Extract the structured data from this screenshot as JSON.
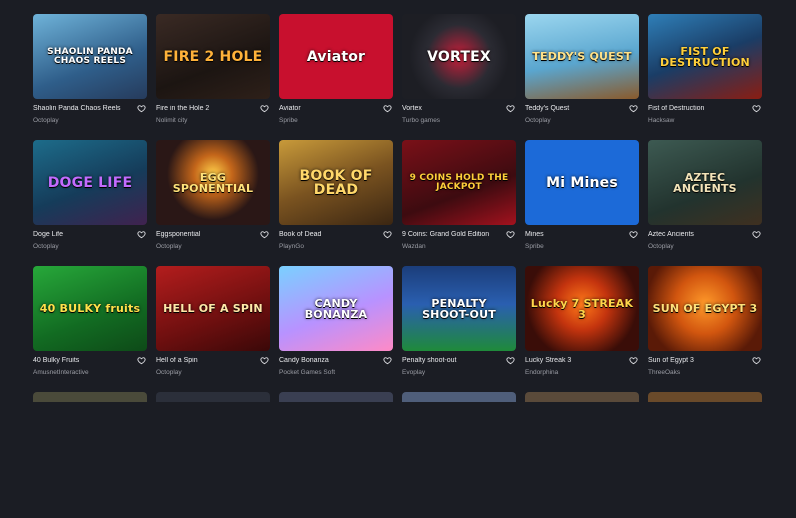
{
  "games": [
    {
      "title": "Shaolin Panda Chaos Reels",
      "provider": "Octoplay",
      "art": "SHAOLIN PANDA CHAOS REELS",
      "bg": "linear-gradient(160deg,#6fb3d9,#2f5e8a 60%,#263b5c)",
      "fg": "#ffffff"
    },
    {
      "title": "Fire in the Hole 2",
      "provider": "Nolimit city",
      "art": "FIRE 2 HOLE",
      "bg": "linear-gradient(160deg,#3a2a24,#1c1512 60%,#2e2019)",
      "fg": "#ffb23a"
    },
    {
      "title": "Aviator",
      "provider": "Spribe",
      "art": "Aviator",
      "bg": "#c8102e",
      "fg": "#ffffff"
    },
    {
      "title": "Vortex",
      "provider": "Turbo games",
      "art": "VORTEX",
      "bg": "radial-gradient(circle,#c81e3a 0,#2b2b33 45%,#1d1e24 70%)",
      "fg": "#ffffff"
    },
    {
      "title": "Teddy's Quest",
      "provider": "Octoplay",
      "art": "TEDDY'S QUEST",
      "bg": "linear-gradient(170deg,#9bd6ef,#5aa6cf 55%,#8a5a2b)",
      "fg": "#ffe28a"
    },
    {
      "title": "Fist of Destruction",
      "provider": "Hacksaw",
      "art": "FIST OF DESTRUCTION",
      "bg": "linear-gradient(160deg,#2f7fb8,#1a3d66 50%,#8a1d12)",
      "fg": "#ffcf3a"
    },
    {
      "title": "Doge Life",
      "provider": "Octoplay",
      "art": "DOGE LIFE",
      "bg": "linear-gradient(160deg,#1d6c8a,#153c5a 55%,#40224f)",
      "fg": "#c36bff"
    },
    {
      "title": "Eggsponential",
      "provider": "Octoplay",
      "art": "EGG SPONENTIAL",
      "bg": "radial-gradient(circle at 50% 40%,#ffcf4a 0,#c4661a 25%,#2a1716 60%)",
      "fg": "#ffe27a"
    },
    {
      "title": "Book of Dead",
      "provider": "PlaynGo",
      "art": "BOOK OF DEAD",
      "bg": "linear-gradient(160deg,#c89a3a,#7a5320 50%,#3b2612)",
      "fg": "#ffd86a"
    },
    {
      "title": "9 Coins: Grand Gold Edition",
      "provider": "Wazdan",
      "art": "9 COINS HOLD THE JACKPOT",
      "bg": "linear-gradient(160deg,#7a1018,#3d0b10 60%,#a3121e)",
      "fg": "#ffcf3a"
    },
    {
      "title": "Mines",
      "provider": "Spribe",
      "art": "Mi Mines",
      "bg": "#1c6ad8",
      "fg": "#ffffff"
    },
    {
      "title": "Aztec Ancients",
      "provider": "Octoplay",
      "art": "AZTEC ANCIENTS",
      "bg": "linear-gradient(160deg,#3d5a52,#22332e 60%,#3f3020)",
      "fg": "#f2e3b8"
    },
    {
      "title": "40 Bulky Fruits",
      "provider": "AmusnetInteractive",
      "art": "40 BULKY fruits",
      "bg": "linear-gradient(160deg,#27a83a,#126b22 60%,#0e4a18)",
      "fg": "#ffe14a"
    },
    {
      "title": "Hell of a Spin",
      "provider": "Octoplay",
      "art": "HELL OF A SPIN",
      "bg": "linear-gradient(160deg,#b31d1d,#6e0f0f 60%,#3a0808)",
      "fg": "#ffe8a8"
    },
    {
      "title": "Candy Bonanza",
      "provider": "Pocket Games Soft",
      "art": "CANDY BONANZA",
      "bg": "linear-gradient(160deg,#7ad0ff,#b892ff 55%,#ff8ac6)",
      "fg": "#ffffff"
    },
    {
      "title": "Penalty shoot-out",
      "provider": "Evoplay",
      "art": "PENALTY SHOOT-OUT",
      "bg": "linear-gradient(180deg,#1b3d7a,#2a5fb0 45%,#1f8a3a)",
      "fg": "#ffffff"
    },
    {
      "title": "Lucky Streak 3",
      "provider": "Endorphina",
      "art": "Lucky 7 STREAK 3",
      "bg": "radial-gradient(circle at 50% 45%,#ff7a1a 0,#c4340e 35%,#3a0d08 75%)",
      "fg": "#ffd54a"
    },
    {
      "title": "Sun of Egypt 3",
      "provider": "ThreeOaks",
      "art": "SUN OF EGYPT 3",
      "bg": "radial-gradient(circle at 50% 45%,#ff9a2a 0,#d2560f 40%,#5a1a07 80%)",
      "fg": "#ffe07a"
    }
  ],
  "next_row_count": 6,
  "heart_icon": "heart-outline-icon"
}
